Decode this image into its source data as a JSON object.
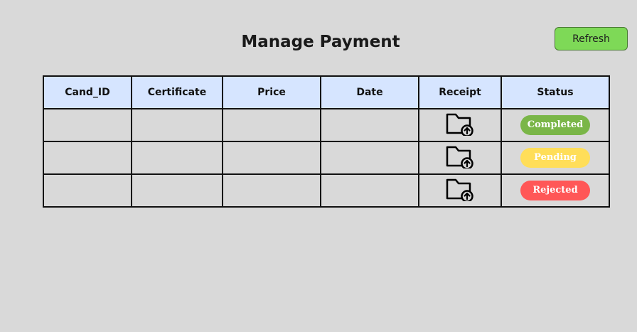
{
  "page": {
    "title": "Manage Payment"
  },
  "toolbar": {
    "refresh_label": "Refresh"
  },
  "table": {
    "headers": [
      "Cand_ID",
      "Certificate",
      "Price",
      "Date",
      "Receipt",
      "Status"
    ],
    "rows": [
      {
        "cand_id": "",
        "certificate": "",
        "price": "",
        "date": "",
        "receipt_icon": "folder-upload-icon",
        "status": "Completed",
        "status_color": "#7ab648"
      },
      {
        "cand_id": "",
        "certificate": "",
        "price": "",
        "date": "",
        "receipt_icon": "folder-upload-icon",
        "status": "Pending",
        "status_color": "#ffde59"
      },
      {
        "cand_id": "",
        "certificate": "",
        "price": "",
        "date": "",
        "receipt_icon": "folder-upload-icon",
        "status": "Rejected",
        "status_color": "#ff5757"
      }
    ]
  },
  "colors": {
    "background": "#d9d9d9",
    "header_fill": "#d6e5ff",
    "refresh_button": "#7ed957"
  }
}
